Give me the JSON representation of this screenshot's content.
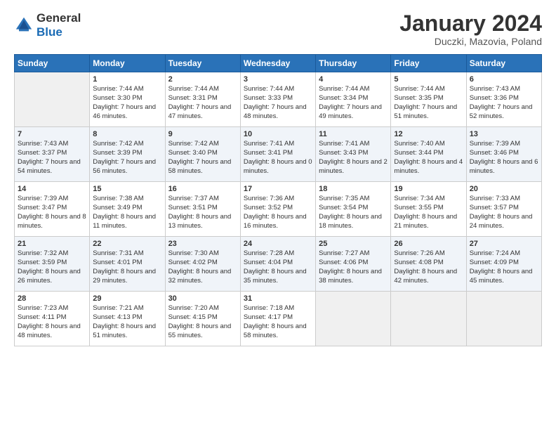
{
  "header": {
    "logo_general": "General",
    "logo_blue": "Blue",
    "month": "January 2024",
    "location": "Duczki, Mazovia, Poland"
  },
  "days_of_week": [
    "Sunday",
    "Monday",
    "Tuesday",
    "Wednesday",
    "Thursday",
    "Friday",
    "Saturday"
  ],
  "weeks": [
    [
      {
        "day": "",
        "empty": true
      },
      {
        "day": "1",
        "sunrise": "7:44 AM",
        "sunset": "3:30 PM",
        "daylight": "7 hours and 46 minutes."
      },
      {
        "day": "2",
        "sunrise": "7:44 AM",
        "sunset": "3:31 PM",
        "daylight": "7 hours and 47 minutes."
      },
      {
        "day": "3",
        "sunrise": "7:44 AM",
        "sunset": "3:33 PM",
        "daylight": "7 hours and 48 minutes."
      },
      {
        "day": "4",
        "sunrise": "7:44 AM",
        "sunset": "3:34 PM",
        "daylight": "7 hours and 49 minutes."
      },
      {
        "day": "5",
        "sunrise": "7:44 AM",
        "sunset": "3:35 PM",
        "daylight": "7 hours and 51 minutes."
      },
      {
        "day": "6",
        "sunrise": "7:43 AM",
        "sunset": "3:36 PM",
        "daylight": "7 hours and 52 minutes."
      }
    ],
    [
      {
        "day": "7",
        "sunrise": "7:43 AM",
        "sunset": "3:37 PM",
        "daylight": "7 hours and 54 minutes."
      },
      {
        "day": "8",
        "sunrise": "7:42 AM",
        "sunset": "3:39 PM",
        "daylight": "7 hours and 56 minutes."
      },
      {
        "day": "9",
        "sunrise": "7:42 AM",
        "sunset": "3:40 PM",
        "daylight": "7 hours and 58 minutes."
      },
      {
        "day": "10",
        "sunrise": "7:41 AM",
        "sunset": "3:41 PM",
        "daylight": "8 hours and 0 minutes."
      },
      {
        "day": "11",
        "sunrise": "7:41 AM",
        "sunset": "3:43 PM",
        "daylight": "8 hours and 2 minutes."
      },
      {
        "day": "12",
        "sunrise": "7:40 AM",
        "sunset": "3:44 PM",
        "daylight": "8 hours and 4 minutes."
      },
      {
        "day": "13",
        "sunrise": "7:39 AM",
        "sunset": "3:46 PM",
        "daylight": "8 hours and 6 minutes."
      }
    ],
    [
      {
        "day": "14",
        "sunrise": "7:39 AM",
        "sunset": "3:47 PM",
        "daylight": "8 hours and 8 minutes."
      },
      {
        "day": "15",
        "sunrise": "7:38 AM",
        "sunset": "3:49 PM",
        "daylight": "8 hours and 11 minutes."
      },
      {
        "day": "16",
        "sunrise": "7:37 AM",
        "sunset": "3:51 PM",
        "daylight": "8 hours and 13 minutes."
      },
      {
        "day": "17",
        "sunrise": "7:36 AM",
        "sunset": "3:52 PM",
        "daylight": "8 hours and 16 minutes."
      },
      {
        "day": "18",
        "sunrise": "7:35 AM",
        "sunset": "3:54 PM",
        "daylight": "8 hours and 18 minutes."
      },
      {
        "day": "19",
        "sunrise": "7:34 AM",
        "sunset": "3:55 PM",
        "daylight": "8 hours and 21 minutes."
      },
      {
        "day": "20",
        "sunrise": "7:33 AM",
        "sunset": "3:57 PM",
        "daylight": "8 hours and 24 minutes."
      }
    ],
    [
      {
        "day": "21",
        "sunrise": "7:32 AM",
        "sunset": "3:59 PM",
        "daylight": "8 hours and 26 minutes."
      },
      {
        "day": "22",
        "sunrise": "7:31 AM",
        "sunset": "4:01 PM",
        "daylight": "8 hours and 29 minutes."
      },
      {
        "day": "23",
        "sunrise": "7:30 AM",
        "sunset": "4:02 PM",
        "daylight": "8 hours and 32 minutes."
      },
      {
        "day": "24",
        "sunrise": "7:28 AM",
        "sunset": "4:04 PM",
        "daylight": "8 hours and 35 minutes."
      },
      {
        "day": "25",
        "sunrise": "7:27 AM",
        "sunset": "4:06 PM",
        "daylight": "8 hours and 38 minutes."
      },
      {
        "day": "26",
        "sunrise": "7:26 AM",
        "sunset": "4:08 PM",
        "daylight": "8 hours and 42 minutes."
      },
      {
        "day": "27",
        "sunrise": "7:24 AM",
        "sunset": "4:09 PM",
        "daylight": "8 hours and 45 minutes."
      }
    ],
    [
      {
        "day": "28",
        "sunrise": "7:23 AM",
        "sunset": "4:11 PM",
        "daylight": "8 hours and 48 minutes."
      },
      {
        "day": "29",
        "sunrise": "7:21 AM",
        "sunset": "4:13 PM",
        "daylight": "8 hours and 51 minutes."
      },
      {
        "day": "30",
        "sunrise": "7:20 AM",
        "sunset": "4:15 PM",
        "daylight": "8 hours and 55 minutes."
      },
      {
        "day": "31",
        "sunrise": "7:18 AM",
        "sunset": "4:17 PM",
        "daylight": "8 hours and 58 minutes."
      },
      {
        "day": "",
        "empty": true
      },
      {
        "day": "",
        "empty": true
      },
      {
        "day": "",
        "empty": true
      }
    ]
  ]
}
